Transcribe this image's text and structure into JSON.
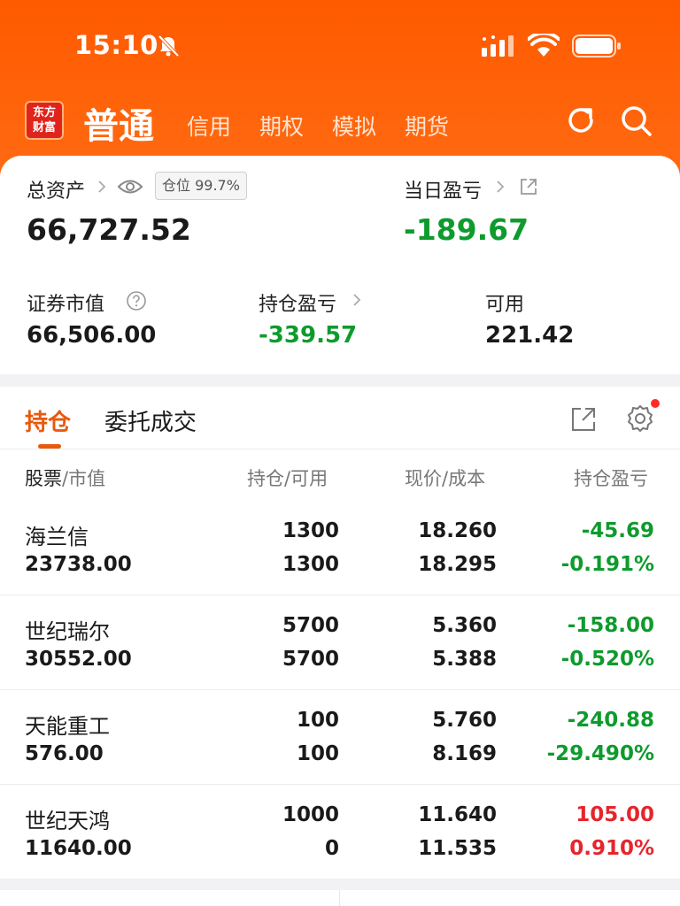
{
  "status_bar": {
    "time": "15:10"
  },
  "nav": {
    "logo_line1": "东方",
    "logo_line2": "财富",
    "active": "普通",
    "tabs": [
      "信用",
      "期权",
      "模拟",
      "期货"
    ]
  },
  "summary": {
    "total_assets_label": "总资产",
    "position_badge": "仓位 99.7%",
    "total_assets_value": "66,727.52",
    "daily_pnl_label": "当日盈亏",
    "daily_pnl_value": "-189.67",
    "market_value_label": "证券市值",
    "market_value": "66,506.00",
    "holding_pnl_label": "持仓盈亏",
    "holding_pnl_value": "-339.57",
    "available_label": "可用",
    "available_value": "221.42"
  },
  "list": {
    "tabs": [
      "持仓",
      "委托成交"
    ],
    "headers": {
      "stock": "股票",
      "market_value": "市值",
      "position": "持仓",
      "available": "可用",
      "price": "现价",
      "cost": "成本",
      "pnl": "持仓盈亏"
    },
    "rows": [
      {
        "name": "海兰信",
        "market_value": "23738.00",
        "position": "1300",
        "available": "1300",
        "price": "18.260",
        "cost": "18.295",
        "pnl": "-45.69",
        "pnl_pct": "-0.191%",
        "trend": "down"
      },
      {
        "name": "世纪瑞尔",
        "market_value": "30552.00",
        "position": "5700",
        "available": "5700",
        "price": "5.360",
        "cost": "5.388",
        "pnl": "-158.00",
        "pnl_pct": "-0.520%",
        "trend": "down"
      },
      {
        "name": "天能重工",
        "market_value": "576.00",
        "position": "100",
        "available": "100",
        "price": "5.760",
        "cost": "8.169",
        "pnl": "-240.88",
        "pnl_pct": "-29.490%",
        "trend": "down"
      },
      {
        "name": "世纪天鸿",
        "market_value": "11640.00",
        "position": "1000",
        "available": "0",
        "price": "11.640",
        "cost": "11.535",
        "pnl": "105.00",
        "pnl_pct": "0.910%",
        "trend": "up"
      }
    ]
  },
  "colors": {
    "brand": "#ff5a00",
    "gain": "#e6252c",
    "loss": "#0e9b2d",
    "tab_active": "#e8590c"
  },
  "icons": [
    "bell-slash-icon",
    "signal-icon",
    "wifi-icon",
    "battery-icon",
    "refresh-icon",
    "search-icon",
    "eye-icon",
    "external-link-icon",
    "help-icon",
    "chevron-right-icon",
    "share-icon",
    "gear-icon"
  ]
}
